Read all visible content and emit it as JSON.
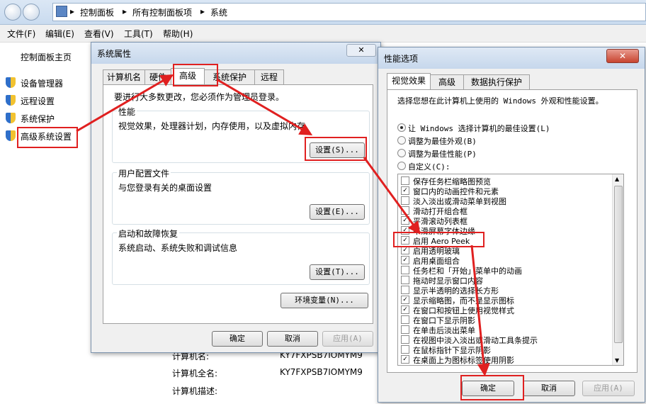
{
  "breadcrumb": [
    "控制面板",
    "所有控制面板项",
    "系统"
  ],
  "menu": [
    "文件(F)",
    "编辑(E)",
    "查看(V)",
    "工具(T)",
    "帮助(H)"
  ],
  "sidebar": {
    "title": "控制面板主页",
    "items": [
      {
        "label": "设备管理器"
      },
      {
        "label": "远程设置"
      },
      {
        "label": "系统保护"
      },
      {
        "label": "高级系统设置"
      }
    ]
  },
  "background": {
    "rows": [
      {
        "label": "计算机名:",
        "value": "KY7FXPSB7IOMYM9"
      },
      {
        "label": "计算机全名:",
        "value": "KY7FXPSB7IOMYM9"
      },
      {
        "label": "计算机描述:",
        "value": ""
      }
    ]
  },
  "sysprops": {
    "title": "系统属性",
    "tabs": [
      "计算机名",
      "硬件",
      "高级",
      "系统保护",
      "远程"
    ],
    "admin_note": "要进行大多数更改，您必须作为管理员登录。",
    "groups": [
      {
        "title": "性能",
        "desc": "视觉效果，处理器计划，内存使用，以及虚拟内存",
        "button": "设置(S)..."
      },
      {
        "title": "用户配置文件",
        "desc": "与您登录有关的桌面设置",
        "button": "设置(E)..."
      },
      {
        "title": "启动和故障恢复",
        "desc": "系统启动、系统失败和调试信息",
        "button": "设置(T)..."
      }
    ],
    "env_button": "环境变量(N)...",
    "ok": "确定",
    "cancel": "取消",
    "apply": "应用(A)"
  },
  "perf": {
    "title": "性能选项",
    "tabs": [
      "视觉效果",
      "高级",
      "数据执行保护"
    ],
    "intro": "选择您想在此计算机上使用的 Windows 外观和性能设置。",
    "radios": [
      {
        "label": "让 Windows 选择计算机的最佳设置(L)",
        "checked": true
      },
      {
        "label": "调整为最佳外观(B)",
        "checked": false
      },
      {
        "label": "调整为最佳性能(P)",
        "checked": false
      },
      {
        "label": "自定义(C):",
        "checked": false
      }
    ],
    "options": [
      {
        "label": "保存任务栏缩略图预览",
        "checked": false
      },
      {
        "label": "窗口内的动画控件和元素",
        "checked": true
      },
      {
        "label": "淡入淡出或滑动菜单到视图",
        "checked": false
      },
      {
        "label": "滑动打开组合框",
        "checked": false
      },
      {
        "label": "平滑滚动列表框",
        "checked": true
      },
      {
        "label": "平滑屏幕字体边缘",
        "checked": true
      },
      {
        "label": "启用 Aero Peek",
        "checked": true
      },
      {
        "label": "启用透明玻璃",
        "checked": true
      },
      {
        "label": "启用桌面组合",
        "checked": true
      },
      {
        "label": "任务栏和「开始」菜单中的动画",
        "checked": false
      },
      {
        "label": "拖动时显示窗口内容",
        "checked": false
      },
      {
        "label": "显示半透明的选择长方形",
        "checked": false
      },
      {
        "label": "显示缩略图，而不是显示图标",
        "checked": true
      },
      {
        "label": "在窗口和按钮上使用视觉样式",
        "checked": true
      },
      {
        "label": "在窗口下显示阴影",
        "checked": false
      },
      {
        "label": "在单击后淡出菜单",
        "checked": false
      },
      {
        "label": "在视图中淡入淡出或滑动工具条提示",
        "checked": false
      },
      {
        "label": "在鼠标指针下显示阴影",
        "checked": false
      },
      {
        "label": "在桌面上为图标标签使用阴影",
        "checked": true
      }
    ],
    "ok": "确定",
    "cancel": "取消",
    "apply": "应用(A)",
    "close_glyph": "✕"
  }
}
